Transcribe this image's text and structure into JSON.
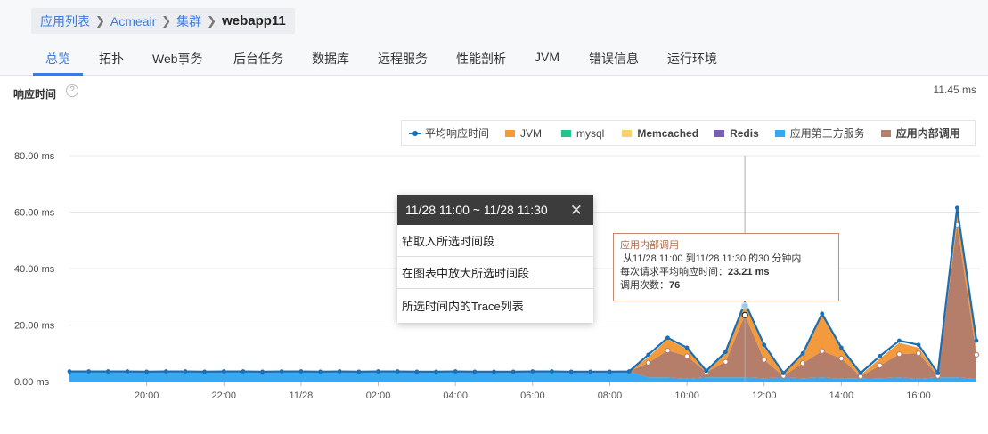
{
  "breadcrumb": {
    "app_list": "应用列表",
    "app": "Acmeair",
    "cluster": "集群",
    "current": "webapp11"
  },
  "tabs": [
    "总览",
    "拓扑",
    "Web事务",
    "后台任务",
    "数据库",
    "远程服务",
    "性能剖析",
    "JVM",
    "错误信息",
    "运行环境"
  ],
  "panel": {
    "title": "响应时间",
    "value": "11.45 ms"
  },
  "popup": {
    "title": "11/28 11:00 ~ 11/28 11:30",
    "items": [
      "钻取入所选时间段",
      "在图表中放大所选时间段",
      "所选时间内的Trace列表"
    ]
  },
  "tooltip": {
    "title": "应用内部调用",
    "line1": "从11/28 11:00 到11/28 11:30 的30 分钟内",
    "avg_label": "每次请求平均响应时间：",
    "avg_value": "23.21 ms",
    "count_label": "调用次数：",
    "count_value": "76"
  },
  "chart_data": {
    "type": "area",
    "title": "响应时间",
    "ylabel": "",
    "ylim": [
      0,
      80
    ],
    "yticks": [
      "0.00 ms",
      "20.00 ms",
      "40.00 ms",
      "60.00 ms",
      "80.00 ms"
    ],
    "xticks": [
      "20:00",
      "22:00",
      "11/28",
      "02:00",
      "04:00",
      "06:00",
      "08:00",
      "10:00",
      "12:00",
      "14:00",
      "16:00"
    ],
    "x": [
      "18:00",
      "18:30",
      "19:00",
      "19:30",
      "20:00",
      "20:30",
      "21:00",
      "21:30",
      "22:00",
      "22:30",
      "23:00",
      "23:30",
      "00:00",
      "00:30",
      "01:00",
      "01:30",
      "02:00",
      "02:30",
      "03:00",
      "03:30",
      "04:00",
      "04:30",
      "05:00",
      "05:30",
      "06:00",
      "06:30",
      "07:00",
      "07:30",
      "08:00",
      "08:30",
      "09:00",
      "09:30",
      "10:00",
      "10:30",
      "11:00",
      "11:30",
      "12:00",
      "12:30",
      "13:00",
      "13:30",
      "14:00",
      "14:30",
      "15:00",
      "15:30",
      "16:00",
      "16:30",
      "17:00",
      "17:30"
    ],
    "legend": [
      "平均响应时间",
      "JVM",
      "mysql",
      "Memcached",
      "Redis",
      "应用第三方服务",
      "应用内部调用"
    ],
    "colors": {
      "平均响应时间": "#1a6fb5",
      "JVM": "#f39a3c",
      "mysql": "#22c48a",
      "Memcached": "#f9d26b",
      "Redis": "#7b5fb5",
      "应用第三方服务": "#39a8ef",
      "应用内部调用": "#b47e6b"
    },
    "series": [
      {
        "name": "应用第三方服务",
        "values": [
          3.6,
          3.6,
          3.6,
          3.6,
          3.5,
          3.6,
          3.6,
          3.5,
          3.6,
          3.6,
          3.5,
          3.6,
          3.6,
          3.5,
          3.6,
          3.5,
          3.6,
          3.6,
          3.5,
          3.5,
          3.6,
          3.5,
          3.5,
          3.5,
          3.6,
          3.6,
          3.5,
          3.5,
          3.5,
          3.6,
          1.5,
          1.5,
          1.0,
          1.5,
          1.5,
          1.5,
          1.2,
          1.5,
          1.2,
          1.5,
          1.0,
          1.0,
          1.2,
          1.5,
          1.0,
          1.5,
          1.5,
          1.0
        ]
      },
      {
        "name": "应用内部调用",
        "values": [
          0,
          0,
          0,
          0,
          0,
          0,
          0,
          0,
          0,
          0,
          0,
          0,
          0,
          0,
          0,
          0,
          0,
          0,
          0,
          0,
          0,
          0,
          0,
          0,
          0,
          0,
          0,
          0,
          0,
          0,
          5.2,
          9.5,
          8.0,
          1.8,
          5.5,
          22.0,
          6.5,
          0.5,
          5.3,
          9.3,
          7.2,
          0.8,
          4.5,
          8.2,
          9.0,
          0.5,
          54.0,
          8.5
        ]
      },
      {
        "name": "JVM",
        "values": [
          0,
          0,
          0,
          0,
          0,
          0,
          0,
          0,
          0,
          0,
          0,
          0,
          0,
          0,
          0,
          0,
          0,
          0,
          0,
          0,
          0,
          0,
          0,
          0,
          0,
          0,
          0,
          0,
          0,
          0,
          2.0,
          4.0,
          2.5,
          0.5,
          3.0,
          4.5,
          4.5,
          1.0,
          3.5,
          13.0,
          3.5,
          0.5,
          2.5,
          4.0,
          2.0,
          0.5,
          5.5,
          4.0
        ]
      },
      {
        "name": "平均响应时间",
        "values": [
          3.6,
          3.6,
          3.6,
          3.6,
          3.5,
          3.6,
          3.6,
          3.5,
          3.6,
          3.6,
          3.5,
          3.6,
          3.6,
          3.5,
          3.6,
          3.5,
          3.6,
          3.6,
          3.5,
          3.5,
          3.6,
          3.5,
          3.5,
          3.5,
          3.6,
          3.6,
          3.5,
          3.5,
          3.5,
          3.6,
          9.5,
          15.5,
          12.0,
          3.8,
          10.5,
          28.0,
          13.0,
          3.0,
          10.0,
          24.0,
          12.0,
          3.0,
          9.0,
          14.5,
          13.0,
          3.0,
          61.5,
          14.5
        ]
      }
    ],
    "highlight": {
      "x": "11:30",
      "label": "应用内部调用",
      "value": 23.21
    },
    "grid": true,
    "legend_position": "top-right"
  }
}
